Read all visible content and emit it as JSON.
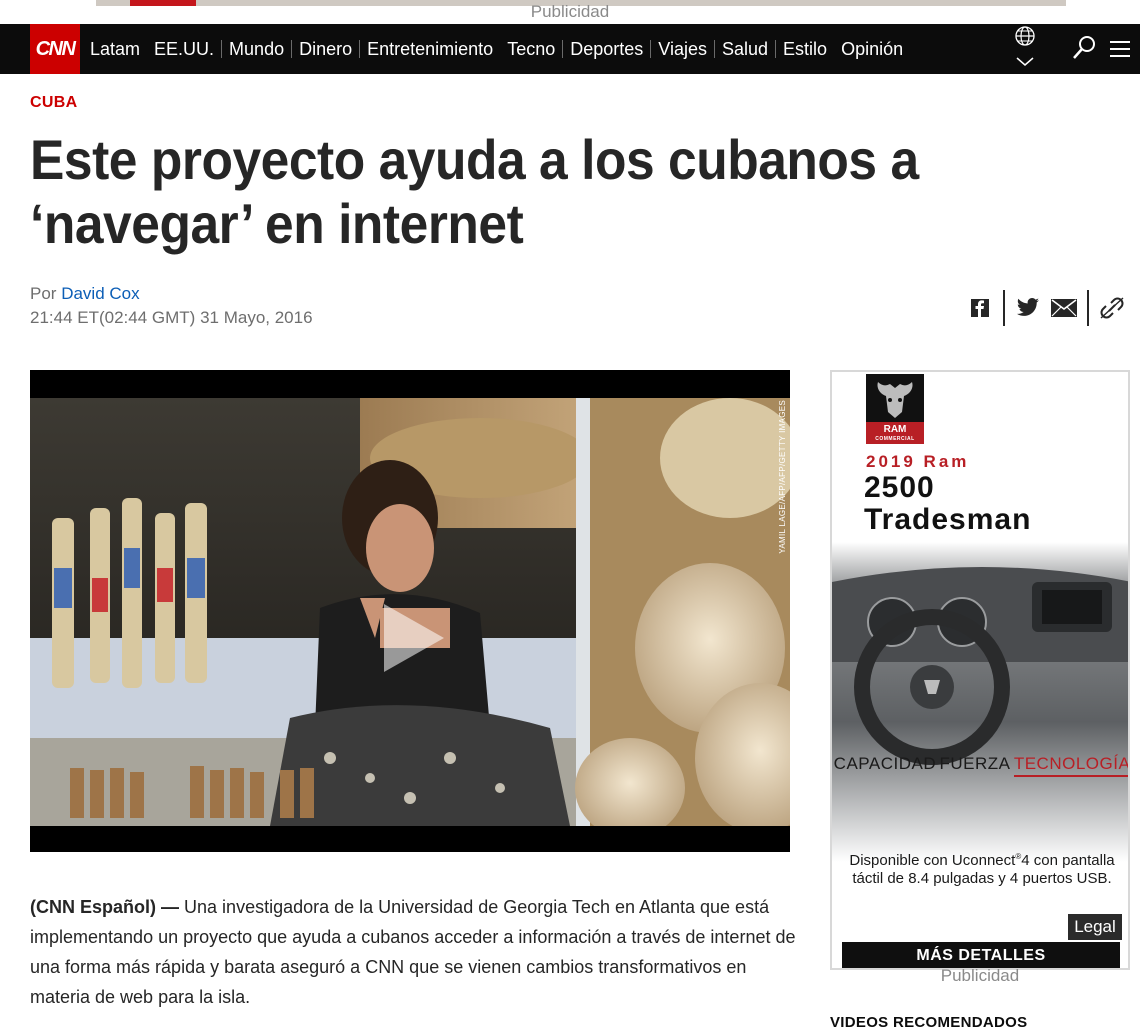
{
  "top_ad": {
    "label": "Publicidad"
  },
  "nav": {
    "logo": "CNN",
    "items": [
      "Latam",
      "EE.UU.",
      "Mundo",
      "Dinero",
      "Entretenimiento",
      "Tecno",
      "Deportes",
      "Viajes",
      "Salud",
      "Estilo",
      "Opinión"
    ]
  },
  "article": {
    "section": "CUBA",
    "headline": "Este proyecto ayuda a los cubanos a ‘navegar’ en internet",
    "byline_prefix": "Por",
    "author": "David Cox",
    "timestamp": "21:44 ET(02:44 GMT) 31 Mayo, 2016",
    "photo_credit": "YAMIL LAGE/AFP/AFP/GETTY IMAGES",
    "lead": "(CNN Español) —",
    "body": "Una investigadora de la Universidad de Georgia Tech en Atlanta que está implementando un proyecto que ayuda a cubanos acceder a información a través de internet de una forma más rápida y barata aseguró a CNN que se vienen cambios transformativos en materia de web para la isla."
  },
  "share": {
    "icons": [
      "facebook-icon",
      "twitter-icon",
      "email-icon",
      "link-icon"
    ]
  },
  "side_ad": {
    "logo_text": "RAM",
    "logo_sub": "COMMERCIAL",
    "year": "2019 Ram",
    "model_line1": "2500",
    "model_line2": "Tradesman",
    "tabs": [
      "CAPACIDAD",
      "FUERZA",
      "TECNOLOGÍA"
    ],
    "active_tab": "TECNOLOGÍA",
    "desc_pre": "Disponible con Uconnect",
    "desc_sup": "®",
    "desc_post": "4 con pantalla táctil de 8.4 pulgadas y 4 puertos USB.",
    "legal": "Legal",
    "cta": "MÁS DETALLES",
    "label": "Publicidad"
  },
  "sidebar": {
    "videos_header": "VIDEOS RECOMENDADOS"
  },
  "colors": {
    "brand_red": "#cc0000",
    "nav_bg": "#0c0c0c",
    "link_blue": "#0c5eb6",
    "ram_red": "#b81f25"
  }
}
